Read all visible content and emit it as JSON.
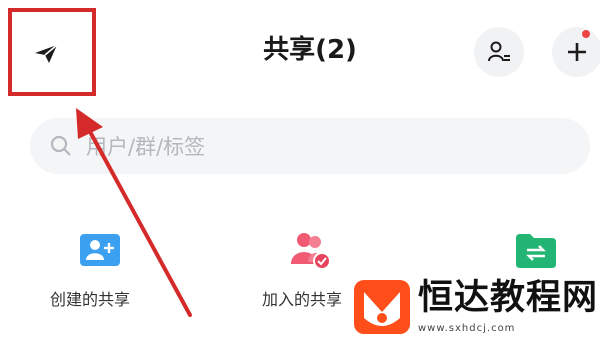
{
  "header": {
    "title": "共享(2)",
    "send_icon": "paper-plane-icon",
    "contacts_icon": "contacts-list-icon",
    "add_icon": "plus-icon"
  },
  "search": {
    "placeholder": "用户/群/标签",
    "icon": "search-icon"
  },
  "categories": [
    {
      "label": "创建的共享",
      "icon": "user-plus-folder-icon",
      "color": "#3aa0ef"
    },
    {
      "label": "加入的共享",
      "icon": "group-check-icon",
      "color": "#f05a72"
    },
    {
      "label": "",
      "icon": "shared-folder-icon",
      "color": "#22b573"
    }
  ],
  "annotation": {
    "highlight_color": "#d42a2a"
  },
  "watermark": {
    "brand": "恒达教程网",
    "url": "www.sxhdcj.com",
    "logo_color": "#ff4e1a"
  }
}
